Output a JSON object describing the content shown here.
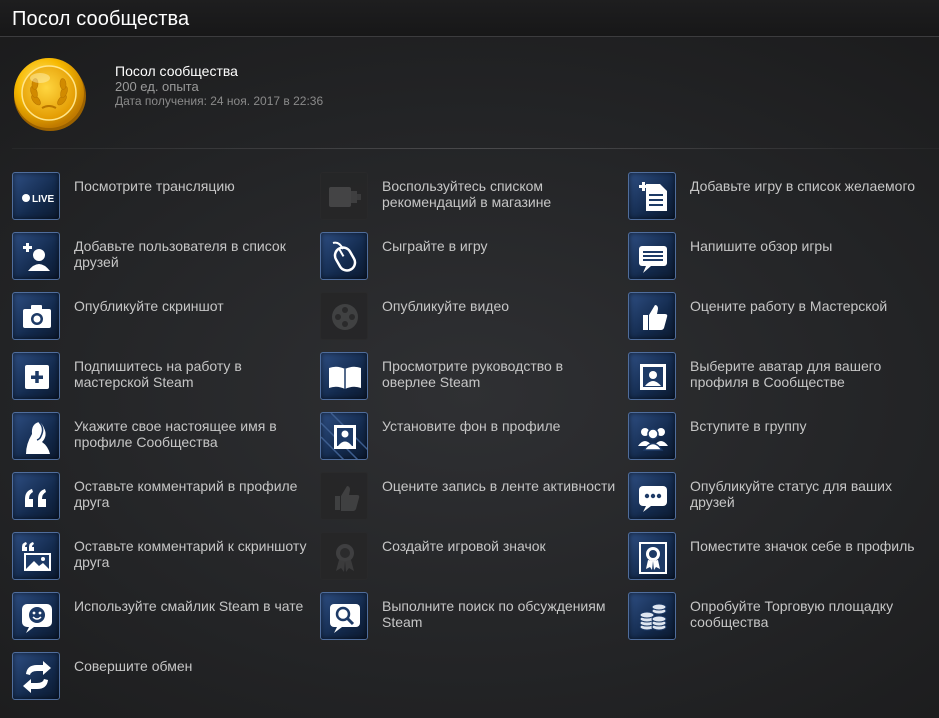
{
  "header": {
    "title": "Посол сообщества"
  },
  "badge": {
    "name": "Посол сообщества",
    "xp": "200 ед. опыта",
    "unlocked": "Дата получения: 24 ноя. 2017 в 22:36"
  },
  "colors": {
    "completed_icon_bg": "#1d3a66",
    "completed_icon_border": "#4f6d9c",
    "incomplete_icon_bg": "#262627",
    "text": "#c6c6c6",
    "gold": "#f5b400"
  },
  "tasks": [
    {
      "label": "Посмотрите трансляцию",
      "icon": "live-icon",
      "completed": true
    },
    {
      "label": "Воспользуйтесь списком рекомендаций в магазине",
      "icon": "queue-icon",
      "completed": false
    },
    {
      "label": "Добавьте игру в список желаемого",
      "icon": "wishlist-icon",
      "completed": true
    },
    {
      "label": "Добавьте пользователя в список друзей",
      "icon": "add-friend-icon",
      "completed": true
    },
    {
      "label": "Сыграйте в игру",
      "icon": "mouse-icon",
      "completed": true
    },
    {
      "label": "Напишите обзор игры",
      "icon": "review-icon",
      "completed": true
    },
    {
      "label": "Опубликуйте скриншот",
      "icon": "camera-icon",
      "completed": true
    },
    {
      "label": "Опубликуйте видео",
      "icon": "film-reel-icon",
      "completed": false
    },
    {
      "label": "Оцените работу в Мастерской",
      "icon": "thumbs-up-icon",
      "completed": true
    },
    {
      "label": "Подпишитесь на работу в мастерской Steam",
      "icon": "subscribe-plus-icon",
      "completed": true
    },
    {
      "label": "Просмотрите руководство в оверлее Steam",
      "icon": "book-icon",
      "completed": true
    },
    {
      "label": "Выберите аватар для вашего профиля в Сообществе",
      "icon": "avatar-frame-icon",
      "completed": true
    },
    {
      "label": "Укажите свое настоящее имя в профиле Сообщества",
      "icon": "profile-silhouette-icon",
      "completed": true
    },
    {
      "label": "Установите фон в профиле",
      "icon": "background-icon",
      "completed": true
    },
    {
      "label": "Вступите в группу",
      "icon": "group-icon",
      "completed": true
    },
    {
      "label": "Оставьте комментарий в профиле друга",
      "icon": "quote-icon",
      "completed": true
    },
    {
      "label": "Оцените запись в ленте активности",
      "icon": "rate-activity-icon",
      "completed": false
    },
    {
      "label": "Опубликуйте статус для ваших друзей",
      "icon": "status-bubble-icon",
      "completed": true
    },
    {
      "label": "Оставьте комментарий к скриншоту друга",
      "icon": "screenshot-comment-icon",
      "completed": true
    },
    {
      "label": "Создайте игровой значок",
      "icon": "badge-craft-icon",
      "completed": false
    },
    {
      "label": "Поместите значок себе в профиль",
      "icon": "badge-ribbon-icon",
      "completed": true
    },
    {
      "label": "Используйте смайлик Steam в чате",
      "icon": "emoticon-icon",
      "completed": true
    },
    {
      "label": "Выполните поиск по обсуждениям Steam",
      "icon": "search-icon",
      "completed": true
    },
    {
      "label": "Опробуйте Торговую площадку сообщества",
      "icon": "coins-icon",
      "completed": true
    },
    {
      "label": "Совершите обмен",
      "icon": "trade-arrows-icon",
      "completed": true
    }
  ],
  "icons": {
    "live_text": "LIVE"
  }
}
